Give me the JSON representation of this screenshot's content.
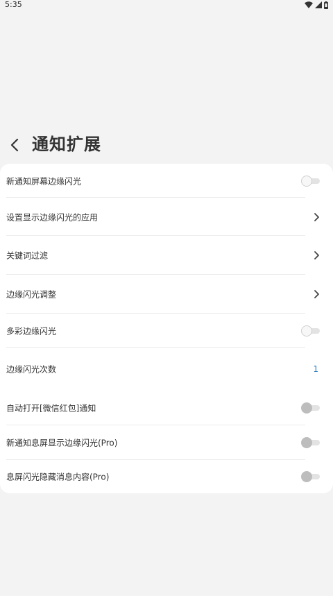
{
  "status_bar": {
    "time": "5:35",
    "icons": [
      "wifi-icon",
      "signal-icon",
      "battery-icon"
    ]
  },
  "header": {
    "back_icon": "chevron-left-icon",
    "title": "通知扩展"
  },
  "settings": {
    "items": [
      {
        "label": "新通知屏幕边缘闪光",
        "control": "toggle",
        "on": false
      },
      {
        "label": "设置显示边缘闪光的应用",
        "control": "chevron"
      },
      {
        "label": "关键词过滤",
        "control": "chevron"
      },
      {
        "label": "边缘闪光调整",
        "control": "chevron"
      },
      {
        "label": "多彩边缘闪光",
        "control": "toggle",
        "on": false
      },
      {
        "label": "边缘闪光次数",
        "control": "value",
        "value": "1"
      },
      {
        "label": "自动打开[微信红包]通知",
        "control": "toggle",
        "on": false
      },
      {
        "label": "新通知息屏显示边缘闪光(Pro)",
        "control": "toggle",
        "on": false
      },
      {
        "label": "息屏闪光隐藏消息内容(Pro)",
        "control": "toggle",
        "on": false
      }
    ]
  },
  "colors": {
    "background": "#f3f3f3",
    "card": "#ffffff",
    "value_accent": "#2a7fbf"
  }
}
